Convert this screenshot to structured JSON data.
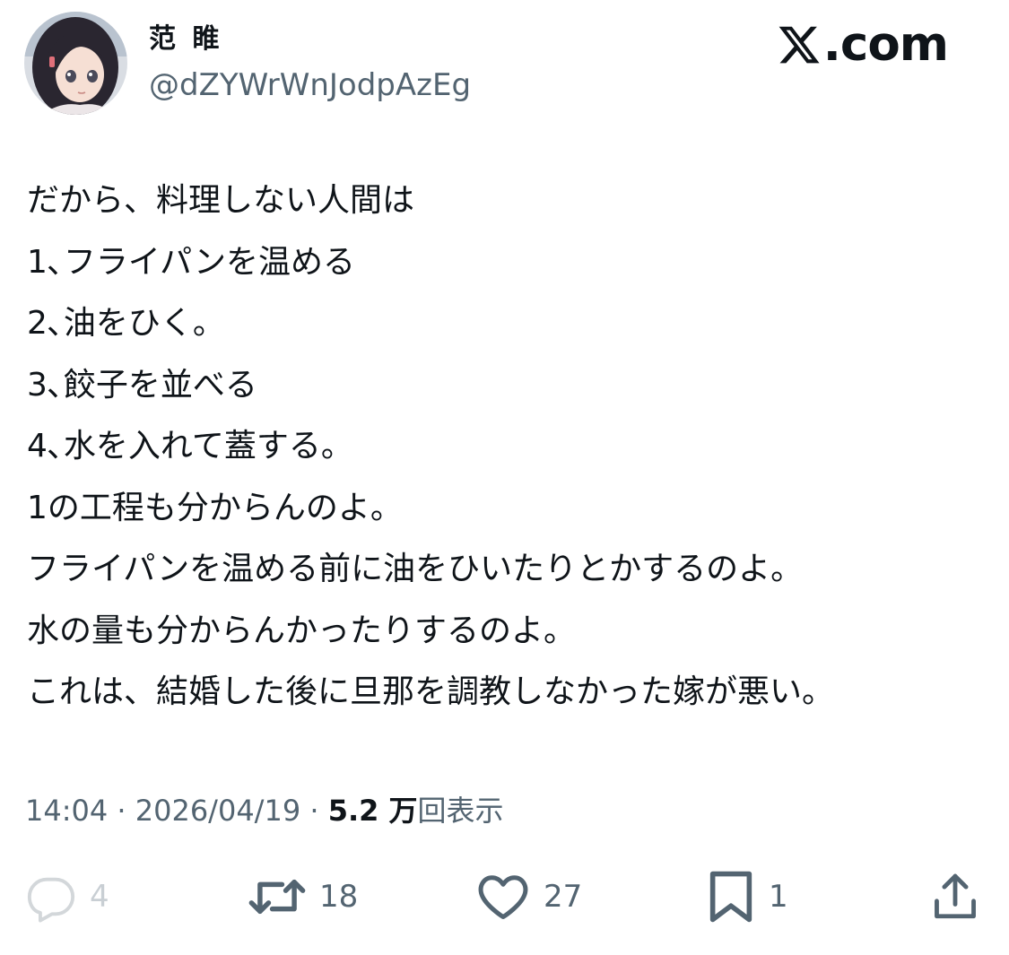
{
  "user": {
    "display_name": "范 睢",
    "handle": "@dZYWrWnJodpAzEg"
  },
  "brand": {
    "label": ".com",
    "icon": "x-logo-icon"
  },
  "tweet": {
    "lines": [
      "だから、料理しない人間は",
      "1､フライパンを温める",
      "2､油をひく。",
      "3､餃子を並べる",
      "4､水を入れて蓋する。",
      "1の工程も分からんのよ。",
      "フライパンを温める前に油をひいたりとかするのよ。",
      "水の量も分からんかったりするのよ。",
      "これは、結婚した後に旦那を調教しなかった嫁が悪い。"
    ]
  },
  "meta": {
    "time": "14:04",
    "separator": " · ",
    "date": "2026/04/19",
    "views_count": "5.2 万",
    "views_label": "回表示"
  },
  "actions": {
    "reply": {
      "count": "4",
      "icon": "reply-icon"
    },
    "repost": {
      "count": "18",
      "icon": "repost-icon"
    },
    "like": {
      "count": "27",
      "icon": "heart-icon"
    },
    "bookmark": {
      "count": "1",
      "icon": "bookmark-icon"
    },
    "share": {
      "icon": "share-icon"
    }
  },
  "colors": {
    "text_primary": "#0f1419",
    "text_secondary": "#536471"
  }
}
